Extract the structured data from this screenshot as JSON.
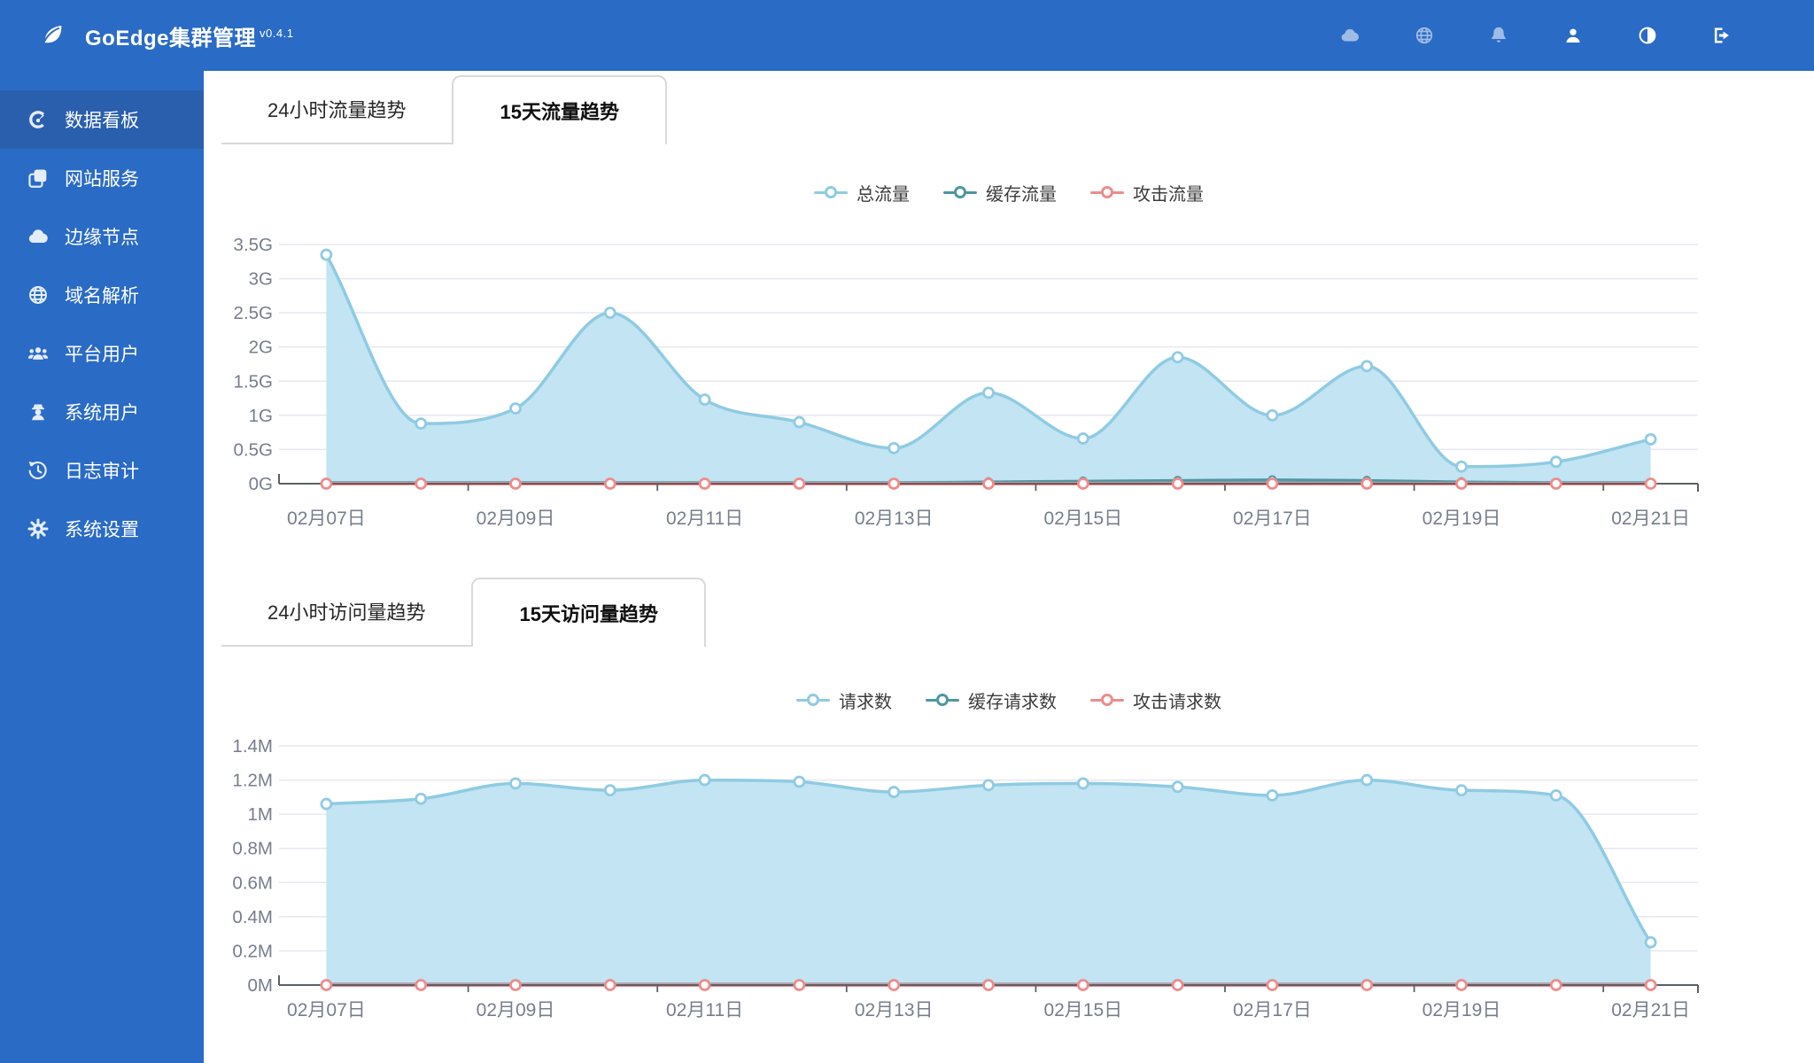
{
  "header": {
    "title": "GoEdge集群管理",
    "version": "v0.4.1",
    "toolbar_icons": [
      {
        "name": "cloud",
        "dim": true
      },
      {
        "name": "globe",
        "dim": true
      },
      {
        "name": "bell",
        "dim": true
      },
      {
        "name": "user",
        "dim": false
      },
      {
        "name": "contrast",
        "dim": false
      },
      {
        "name": "logout",
        "dim": false
      }
    ]
  },
  "sidebar": {
    "items": [
      {
        "label": "数据看板",
        "icon": "dashboard",
        "active": true
      },
      {
        "label": "网站服务",
        "icon": "websites",
        "active": false
      },
      {
        "label": "边缘节点",
        "icon": "nodes",
        "active": false
      },
      {
        "label": "域名解析",
        "icon": "dns",
        "active": false
      },
      {
        "label": "平台用户",
        "icon": "platform-users",
        "active": false
      },
      {
        "label": "系统用户",
        "icon": "system-users",
        "active": false
      },
      {
        "label": "日志审计",
        "icon": "logs",
        "active": false
      },
      {
        "label": "系统设置",
        "icon": "settings",
        "active": false
      }
    ]
  },
  "sections": [
    {
      "tabs": [
        {
          "label": "24小时流量趋势",
          "active": false
        },
        {
          "label": "15天流量趋势",
          "active": true
        }
      ]
    },
    {
      "tabs": [
        {
          "label": "24小时访问量趋势",
          "active": false
        },
        {
          "label": "15天访问量趋势",
          "active": true
        }
      ]
    }
  ],
  "chart_data": [
    {
      "type": "area",
      "title": "15天流量趋势",
      "unit": "G",
      "categories": [
        "02月07日",
        "02月08日",
        "02月09日",
        "02月10日",
        "02月11日",
        "02月12日",
        "02月13日",
        "02月14日",
        "02月15日",
        "02月16日",
        "02月17日",
        "02月18日",
        "02月19日",
        "02月20日",
        "02月21日"
      ],
      "x_label_every": 2,
      "x_labels_shown": [
        "02月07日",
        "02月09日",
        "02月11日",
        "02月13日",
        "02月15日",
        "02月17日",
        "02月19日",
        "02月21日"
      ],
      "ylim": [
        0,
        3.5
      ],
      "yticks": [
        "0G",
        "0.5G",
        "1G",
        "1.5G",
        "2G",
        "2.5G",
        "3G",
        "3.5G"
      ],
      "grid": true,
      "legend_position": "top-center",
      "series": [
        {
          "name": "总流量",
          "color": "#8fcbe3",
          "fill": "#c2e4f3",
          "values": [
            3.35,
            0.88,
            1.1,
            2.5,
            1.23,
            0.9,
            0.52,
            1.33,
            0.66,
            1.85,
            1.0,
            1.72,
            0.25,
            0.32,
            0.65
          ]
        },
        {
          "name": "缓存流量",
          "color": "#4e96a3",
          "fill": "#66a1ac",
          "values": [
            0.02,
            0.02,
            0.02,
            0.02,
            0.02,
            0.02,
            0.02,
            0.03,
            0.04,
            0.05,
            0.06,
            0.05,
            0.03,
            0.02,
            0.02
          ]
        },
        {
          "name": "攻击流量",
          "color": "#ee8c8c",
          "fill": null,
          "values": [
            0,
            0,
            0,
            0,
            0,
            0,
            0,
            0,
            0,
            0,
            0,
            0,
            0,
            0,
            0
          ]
        }
      ]
    },
    {
      "type": "area",
      "title": "15天访问量趋势",
      "unit": "M",
      "categories": [
        "02月07日",
        "02月08日",
        "02月09日",
        "02月10日",
        "02月11日",
        "02月12日",
        "02月13日",
        "02月14日",
        "02月15日",
        "02月16日",
        "02月17日",
        "02月18日",
        "02月19日",
        "02月20日",
        "02月21日"
      ],
      "x_label_every": 2,
      "x_labels_shown": [
        "02月07日",
        "02月09日",
        "02月11日",
        "02月13日",
        "02月15日",
        "02月17日",
        "02月19日",
        "02月21日"
      ],
      "ylim": [
        0,
        1.4
      ],
      "yticks": [
        "0M",
        "0.2M",
        "0.4M",
        "0.6M",
        "0.8M",
        "1M",
        "1.2M",
        "1.4M"
      ],
      "grid": true,
      "legend_position": "top-center",
      "series": [
        {
          "name": "请求数",
          "color": "#8fcbe3",
          "fill": "#c2e4f3",
          "values": [
            1.06,
            1.09,
            1.18,
            1.14,
            1.2,
            1.19,
            1.13,
            1.17,
            1.18,
            1.16,
            1.11,
            1.2,
            1.14,
            1.11,
            0.25
          ]
        },
        {
          "name": "缓存请求数",
          "color": "#4e96a3",
          "fill": null,
          "values": [
            0.006,
            0.006,
            0.006,
            0.006,
            0.006,
            0.006,
            0.006,
            0.006,
            0.006,
            0.006,
            0.006,
            0.006,
            0.006,
            0.006,
            0.006
          ]
        },
        {
          "name": "攻击请求数",
          "color": "#ee8c8c",
          "fill": null,
          "values": [
            0,
            0,
            0,
            0,
            0,
            0,
            0,
            0,
            0,
            0,
            0,
            0,
            0,
            0,
            0
          ]
        }
      ]
    }
  ],
  "colors": {
    "brand_blue": "#2a6bc6",
    "sidebar_active": "#2a5fae",
    "chart_blue": "#8fcbe3",
    "chart_blue_fill": "#c2e4f3",
    "chart_teal": "#4e96a3",
    "chart_red": "#ee8c8c",
    "grid_line": "#e5e8f2",
    "axis_line": "#5b6069",
    "axis_text": "#767e8c",
    "tab_border": "#d9d9d9"
  }
}
